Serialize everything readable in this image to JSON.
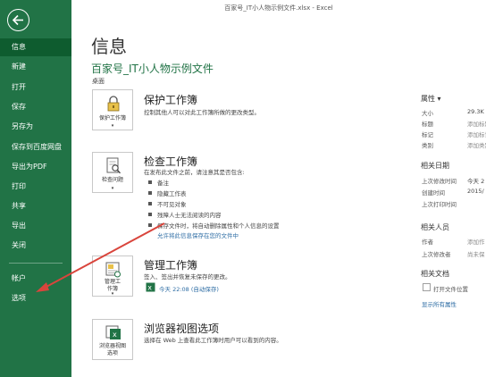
{
  "window": {
    "title": "百家号_IT小人物示例文件.xlsx - Excel"
  },
  "sidebar": {
    "items": [
      {
        "label": "信息",
        "active": true
      },
      {
        "label": "新建"
      },
      {
        "label": "打开"
      },
      {
        "label": "保存"
      },
      {
        "label": "另存为"
      },
      {
        "label": "保存到百度网盘"
      },
      {
        "label": "导出为PDF"
      },
      {
        "label": "打印"
      },
      {
        "label": "共享"
      },
      {
        "label": "导出"
      },
      {
        "label": "关闭"
      },
      {
        "label": "帐户"
      },
      {
        "label": "选项"
      }
    ],
    "color": "#217346",
    "active_color": "#0e5c2f"
  },
  "main": {
    "title": "信息",
    "doc_title": "百家号_IT小人物示例文件",
    "location": "桌面",
    "protect": {
      "tile_label": "保护工作簿",
      "title": "保护工作簿",
      "desc": "控制其他人可以对此工作簿所做的更改类型。"
    },
    "inspect": {
      "tile_label_1": "检查问题",
      "title": "检查工作簿",
      "desc": "在发布此文件之前，请注意其是否包含:",
      "bullets": [
        "备注",
        "隐藏工作表",
        "不可见对象",
        "残障人士无法阅读的内容"
      ],
      "note": "保存文件时，将自动删除属性和个人信息的设置",
      "link": "允许将此信息保存在您的文件中"
    },
    "manage": {
      "tile_label_1": "管理工",
      "tile_label_2": "作簿",
      "title": "管理工作簿",
      "desc": "签入、签出并恢复未保存的更改。",
      "autosave": "今天 22:08 (自动保存)"
    },
    "browser": {
      "tile_label_1": "浏览器视图",
      "tile_label_2": "选项",
      "title": "浏览器视图选项",
      "desc": "选择在 Web 上查看此工作簿时用户可以看到的内容。"
    }
  },
  "properties": {
    "heading": "属性 ▾",
    "rows": [
      {
        "key": "大小",
        "value": "29.3K"
      },
      {
        "key": "标题",
        "value": "添加标题"
      },
      {
        "key": "标记",
        "value": "添加标记"
      },
      {
        "key": "类别",
        "value": "添加类别"
      }
    ],
    "dates_heading": "相关日期",
    "dates": [
      {
        "key": "上次修改时间",
        "value": "今天 2"
      },
      {
        "key": "创建时间",
        "value": "2015/"
      },
      {
        "key": "上次打印时间",
        "value": ""
      }
    ],
    "people_heading": "相关人员",
    "people": [
      {
        "key": "作者",
        "value": "添加作"
      },
      {
        "key": "上次修改者",
        "value": "尚未保"
      }
    ],
    "docs_heading": "相关文档",
    "open_location": "打开文件位置",
    "show_all": "显示所有属性"
  }
}
